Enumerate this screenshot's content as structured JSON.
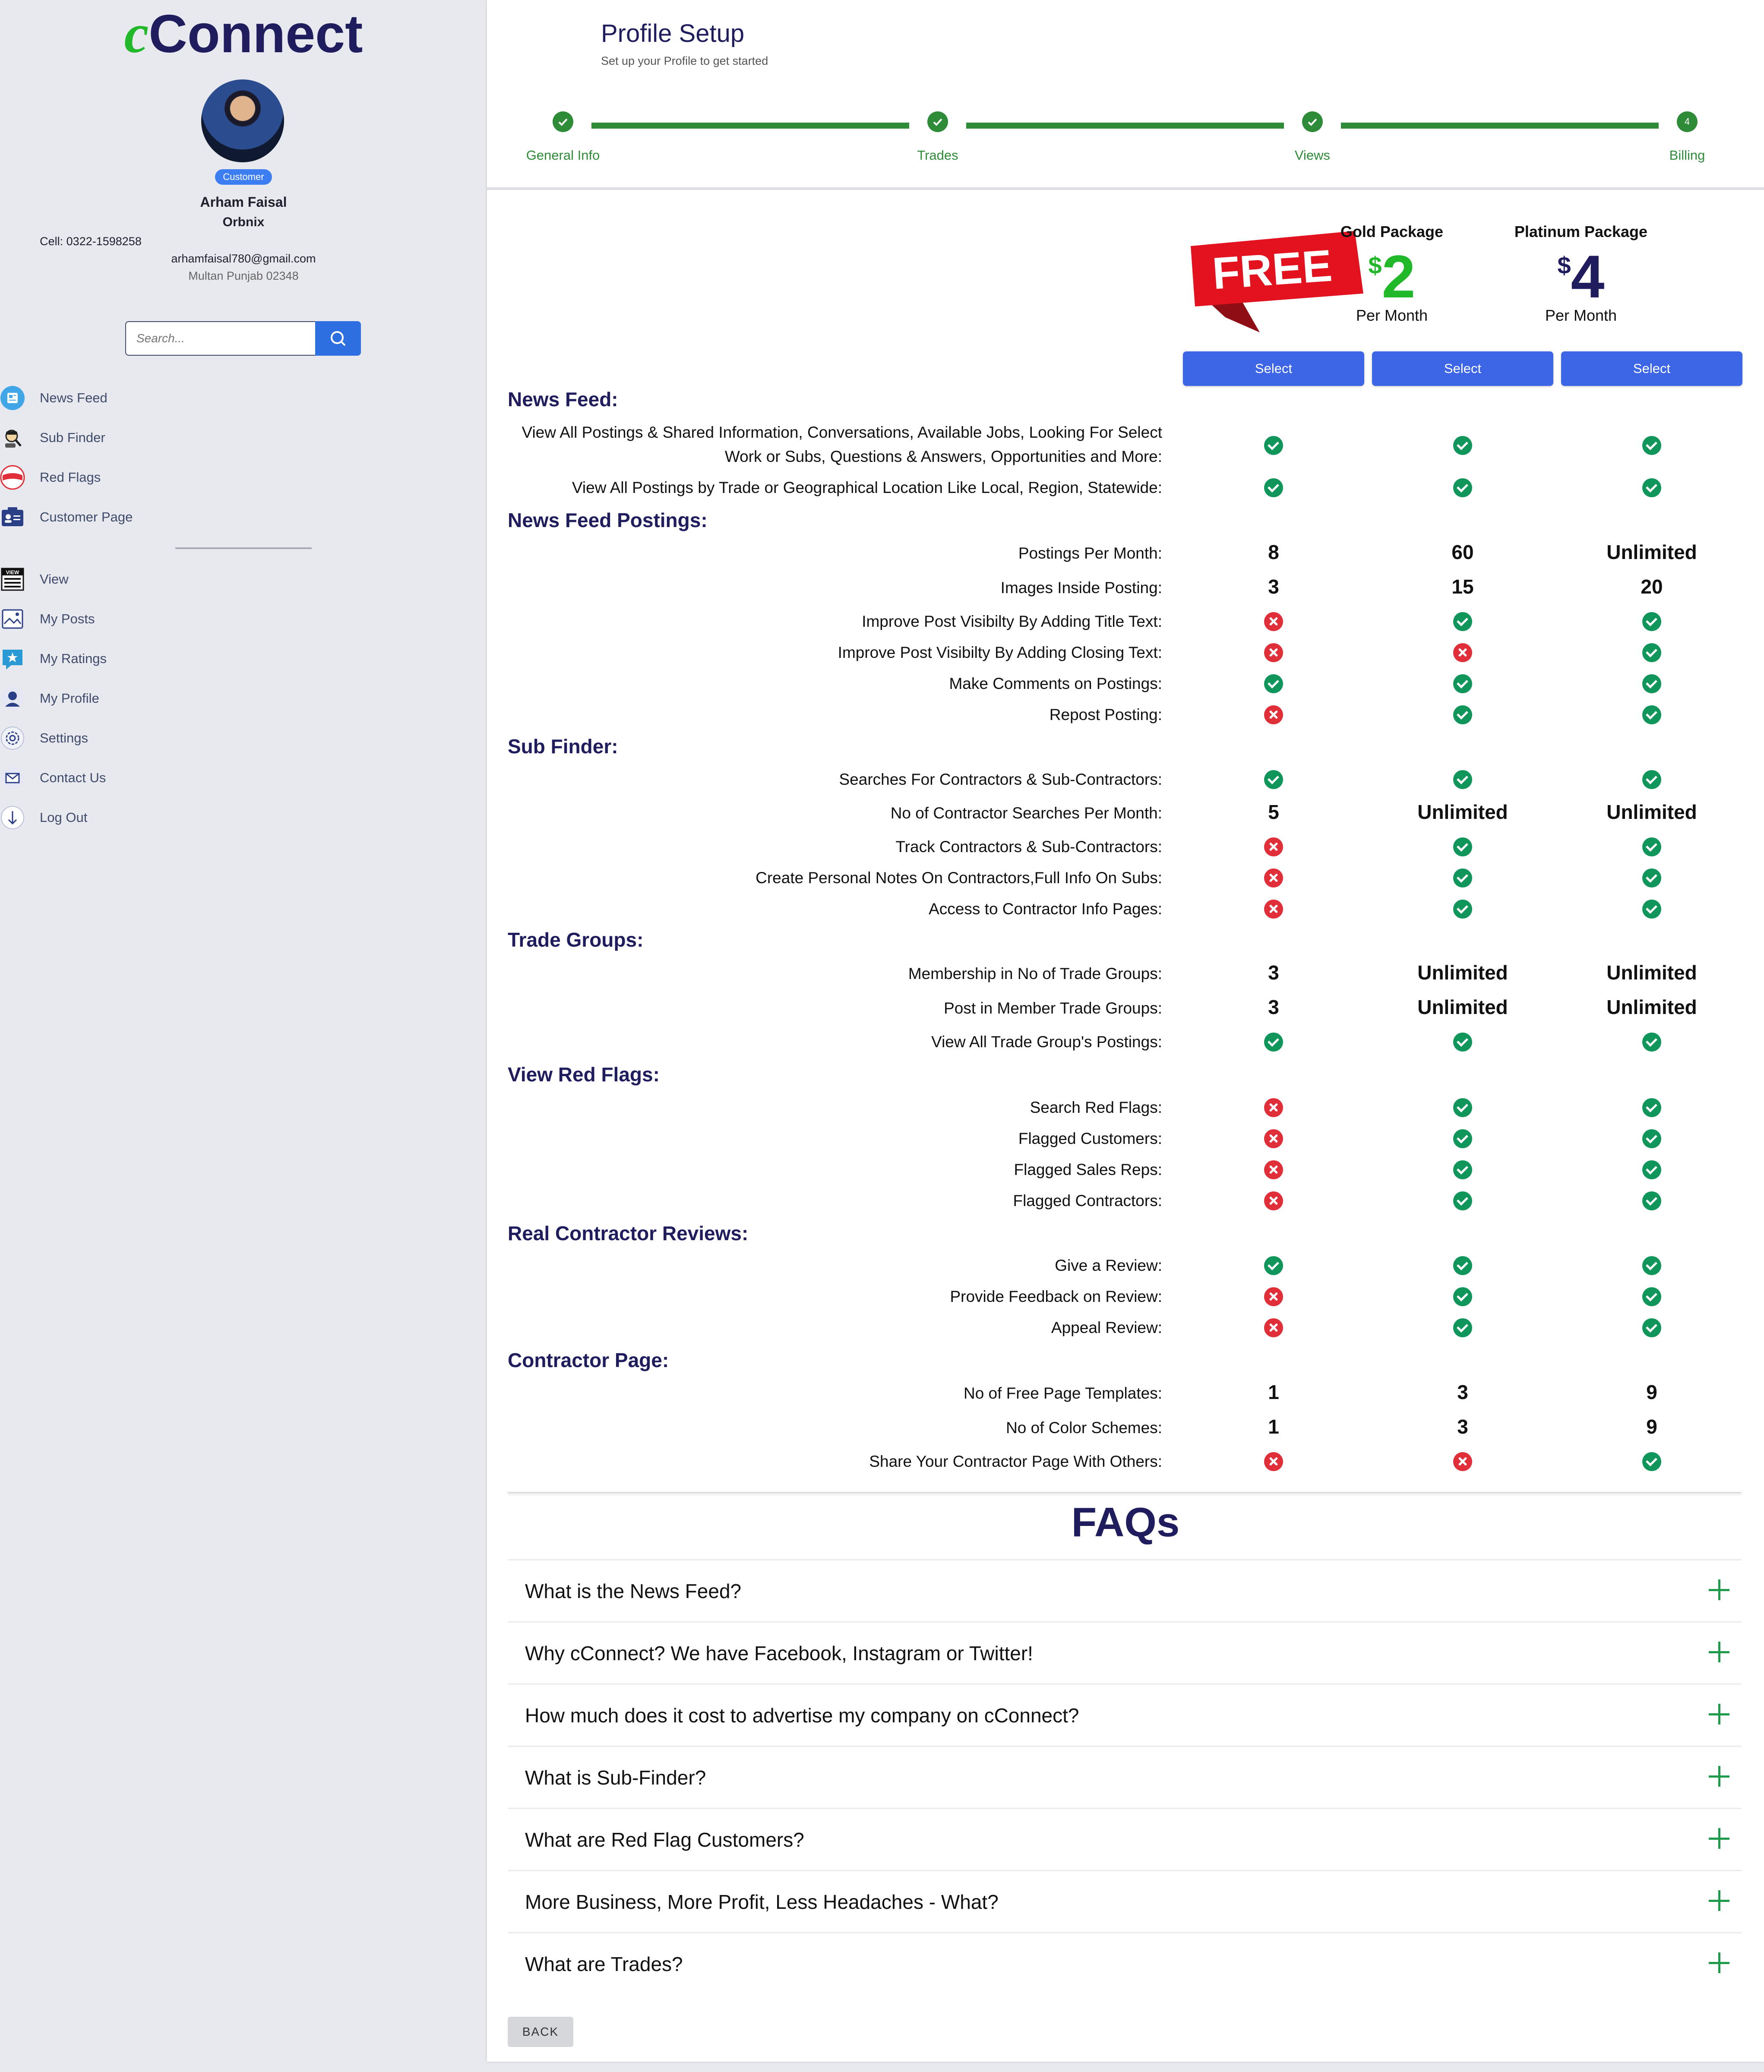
{
  "sidebar": {
    "logo_c": "c",
    "logo_rest": "Connect",
    "badge": "Customer",
    "name": "Arham Faisal",
    "company": "Orbnix",
    "cell": "Cell: 0322-1598258",
    "email": "arhamfaisal780@gmail.com",
    "address": "Multan Punjab 02348",
    "search_placeholder": "Search...",
    "nav": [
      {
        "label": "News Feed",
        "icon": "news-feed-icon"
      },
      {
        "label": "Sub Finder",
        "icon": "sub-finder-icon"
      },
      {
        "label": "Red Flags",
        "icon": "red-flags-icon"
      },
      {
        "label": "Customer Page",
        "icon": "customer-page-icon"
      },
      {
        "label": "View",
        "icon": "view-icon"
      },
      {
        "label": "My Posts",
        "icon": "my-posts-icon"
      },
      {
        "label": "My Ratings",
        "icon": "my-ratings-icon"
      },
      {
        "label": "My Profile",
        "icon": "my-profile-icon"
      },
      {
        "label": "Settings",
        "icon": "settings-icon"
      },
      {
        "label": "Contact Us",
        "icon": "contact-us-icon"
      },
      {
        "label": "Log Out",
        "icon": "log-out-icon"
      }
    ]
  },
  "header": {
    "title": "Profile Setup",
    "subtitle": "Set up your Profile to get started",
    "steps": [
      {
        "label": "General Info",
        "done": true
      },
      {
        "label": "Trades",
        "done": true
      },
      {
        "label": "Views",
        "done": true
      },
      {
        "label": "Billing",
        "number": "4",
        "done": false
      }
    ]
  },
  "packages": {
    "free_label": "FREE",
    "gold": {
      "name": "Gold Package",
      "currency": "$",
      "price": "2",
      "period": "Per Month",
      "color": "#21b82a"
    },
    "platinum": {
      "name": "Platinum Package",
      "currency": "$",
      "price": "4",
      "period": "Per Month",
      "color": "#1f1d5e"
    },
    "select_label": "Select"
  },
  "sections": [
    {
      "title": "News Feed:",
      "rows": [
        {
          "label": "View All Postings & Shared Information, Conversations, Available Jobs, Looking For Select Work or Subs, Questions & Answers, Opportunities and More:",
          "v": [
            "yes",
            "yes",
            "yes"
          ]
        },
        {
          "label": "View All Postings by Trade or Geographical Location Like Local, Region, Statewide:",
          "v": [
            "yes",
            "yes",
            "yes"
          ]
        }
      ]
    },
    {
      "title": "News Feed Postings:",
      "rows": [
        {
          "label": "Postings Per Month:",
          "v": [
            "8",
            "60",
            "Unlimited"
          ]
        },
        {
          "label": "Images Inside Posting:",
          "v": [
            "3",
            "15",
            "20"
          ]
        },
        {
          "label": "Improve Post Visibilty By Adding Title Text:",
          "v": [
            "no",
            "yes",
            "yes"
          ]
        },
        {
          "label": "Improve Post Visibilty By Adding Closing Text:",
          "v": [
            "no",
            "no",
            "yes"
          ]
        },
        {
          "label": "Make Comments on Postings:",
          "v": [
            "yes",
            "yes",
            "yes"
          ]
        },
        {
          "label": "Repost Posting:",
          "v": [
            "no",
            "yes",
            "yes"
          ]
        }
      ]
    },
    {
      "title": "Sub Finder:",
      "rows": [
        {
          "label": "Searches For Contractors & Sub-Contractors:",
          "v": [
            "yes",
            "yes",
            "yes"
          ]
        },
        {
          "label": "No of Contractor Searches Per Month:",
          "v": [
            "5",
            "Unlimited",
            "Unlimited"
          ]
        },
        {
          "label": "Track Contractors & Sub-Contractors:",
          "v": [
            "no",
            "yes",
            "yes"
          ]
        },
        {
          "label": "Create Personal Notes On Contractors,Full Info On Subs:",
          "v": [
            "no",
            "yes",
            "yes"
          ]
        },
        {
          "label": "Access to Contractor Info Pages:",
          "v": [
            "no",
            "yes",
            "yes"
          ]
        }
      ]
    },
    {
      "title": "Trade Groups:",
      "rows": [
        {
          "label": "Membership in No of Trade Groups:",
          "v": [
            "3",
            "Unlimited",
            "Unlimited"
          ]
        },
        {
          "label": "Post in Member Trade Groups:",
          "v": [
            "3",
            "Unlimited",
            "Unlimited"
          ]
        },
        {
          "label": "View All Trade Group's Postings:",
          "v": [
            "yes",
            "yes",
            "yes"
          ]
        }
      ]
    },
    {
      "title": "View Red Flags:",
      "rows": [
        {
          "label": "Search Red Flags:",
          "v": [
            "no",
            "yes",
            "yes"
          ]
        },
        {
          "label": "Flagged Customers:",
          "v": [
            "no",
            "yes",
            "yes"
          ]
        },
        {
          "label": "Flagged Sales Reps:",
          "v": [
            "no",
            "yes",
            "yes"
          ]
        },
        {
          "label": "Flagged Contractors:",
          "v": [
            "no",
            "yes",
            "yes"
          ]
        }
      ]
    },
    {
      "title": "Real Contractor Reviews:",
      "rows": [
        {
          "label": "Give a Review:",
          "v": [
            "yes",
            "yes",
            "yes"
          ]
        },
        {
          "label": "Provide Feedback on Review:",
          "v": [
            "no",
            "yes",
            "yes"
          ]
        },
        {
          "label": "Appeal Review:",
          "v": [
            "no",
            "yes",
            "yes"
          ]
        }
      ]
    },
    {
      "title": "Contractor Page:",
      "rows": [
        {
          "label": "No of Free Page Templates:",
          "v": [
            "1",
            "3",
            "9"
          ]
        },
        {
          "label": "No of Color Schemes:",
          "v": [
            "1",
            "3",
            "9"
          ]
        },
        {
          "label": "Share Your Contractor Page With Others:",
          "v": [
            "no",
            "no",
            "yes"
          ]
        }
      ]
    }
  ],
  "faq": {
    "title": "FAQs",
    "items": [
      "What is the News Feed?",
      "Why cConnect? We have Facebook, Instagram or Twitter!",
      "How much does it cost to advertise my company on cConnect?",
      "What is Sub-Finder?",
      "What are Red Flag Customers?",
      "More Business, More Profit, Less Headaches - What?",
      "What are Trades?"
    ]
  },
  "back_label": "BACK"
}
